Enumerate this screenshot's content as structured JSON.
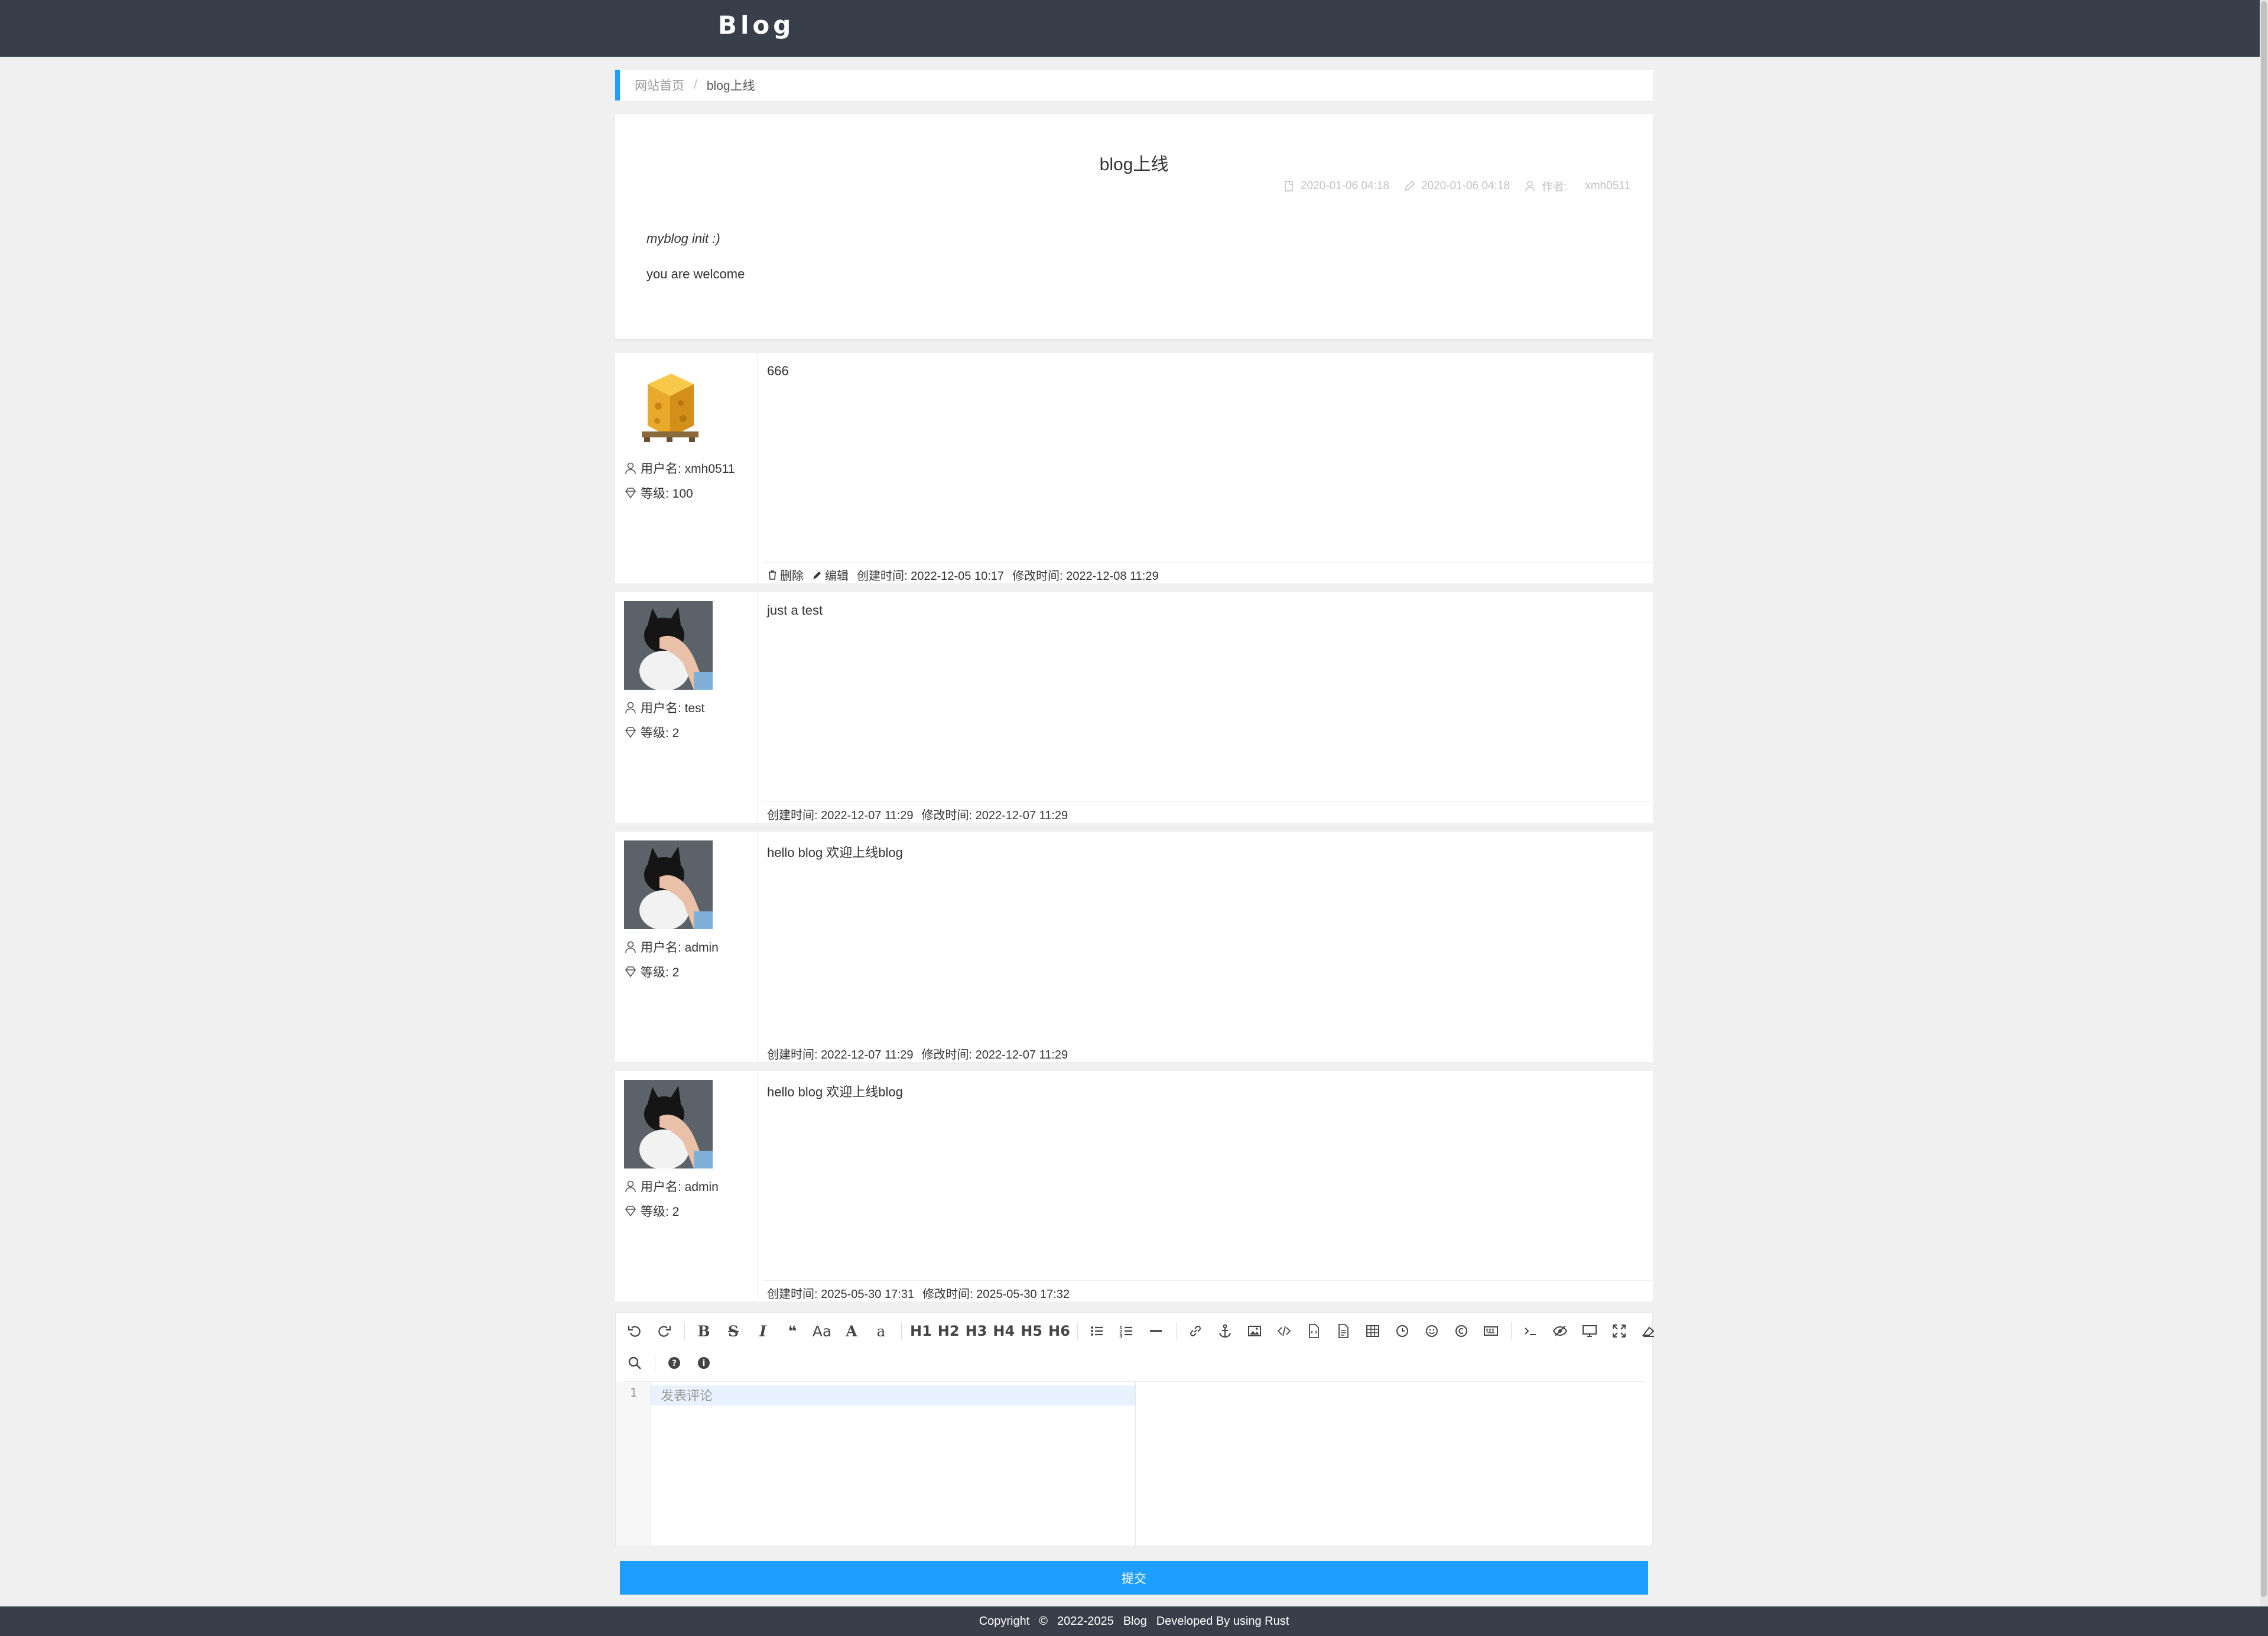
{
  "header": {
    "brand": "Blog"
  },
  "breadcrumb": {
    "home": "网站首页",
    "separator": "/",
    "current": "blog上线"
  },
  "article": {
    "title": "blog上线",
    "created": "2020-01-06 04:18",
    "modified": "2020-01-06 04:18",
    "author_label": "作者:",
    "author": "xmh0511",
    "body_line1": "myblog init :)",
    "body_line2": "you are welcome"
  },
  "comments": [
    {
      "avatar": "cheese-box-icon",
      "username_label": "用户名: xmh0511",
      "level_label": "等级: 100",
      "content": "666",
      "delete_label": "删除",
      "edit_label": "编辑",
      "created_label": "创建时间: 2022-12-05 10:17",
      "modified_label": "修改时间: 2022-12-08 11:29"
    },
    {
      "avatar": "cat-photo",
      "username_label": "用户名: test",
      "level_label": "等级: 2",
      "content": "just a test",
      "created_label": "创建时间: 2022-12-07 11:29",
      "modified_label": "修改时间: 2022-12-07 11:29"
    },
    {
      "avatar": "cat-photo",
      "username_label": "用户名: admin",
      "level_label": "等级: 2",
      "content": "hello blog 欢迎上线blog",
      "created_label": "创建时间: 2022-12-07 11:29",
      "modified_label": "修改时间: 2022-12-07 11:29"
    },
    {
      "avatar": "cat-photo",
      "username_label": "用户名: admin",
      "level_label": "等级: 2",
      "content": "hello blog 欢迎上线blog",
      "created_label": "创建时间: 2025-05-30 17:31",
      "modified_label": "修改时间: 2025-05-30 17:32"
    }
  ],
  "editor": {
    "line_number": "1",
    "placeholder": "发表评论",
    "toolbar_text": {
      "case": "Aa",
      "upper": "A",
      "lower": "a",
      "h1": "H1",
      "h2": "H2",
      "h3": "H3",
      "h4": "H4",
      "h5": "H5",
      "h6": "H6"
    }
  },
  "submit_label": "提交",
  "footer": {
    "copyright": "Copyright",
    "symbol": "©",
    "years": "2022-2025",
    "brand": "Blog",
    "developed": "Developed By using Rust"
  },
  "colors": {
    "header_bg": "#383e4a",
    "accent": "#1e9fff",
    "page_bg": "#f0f0f0"
  }
}
